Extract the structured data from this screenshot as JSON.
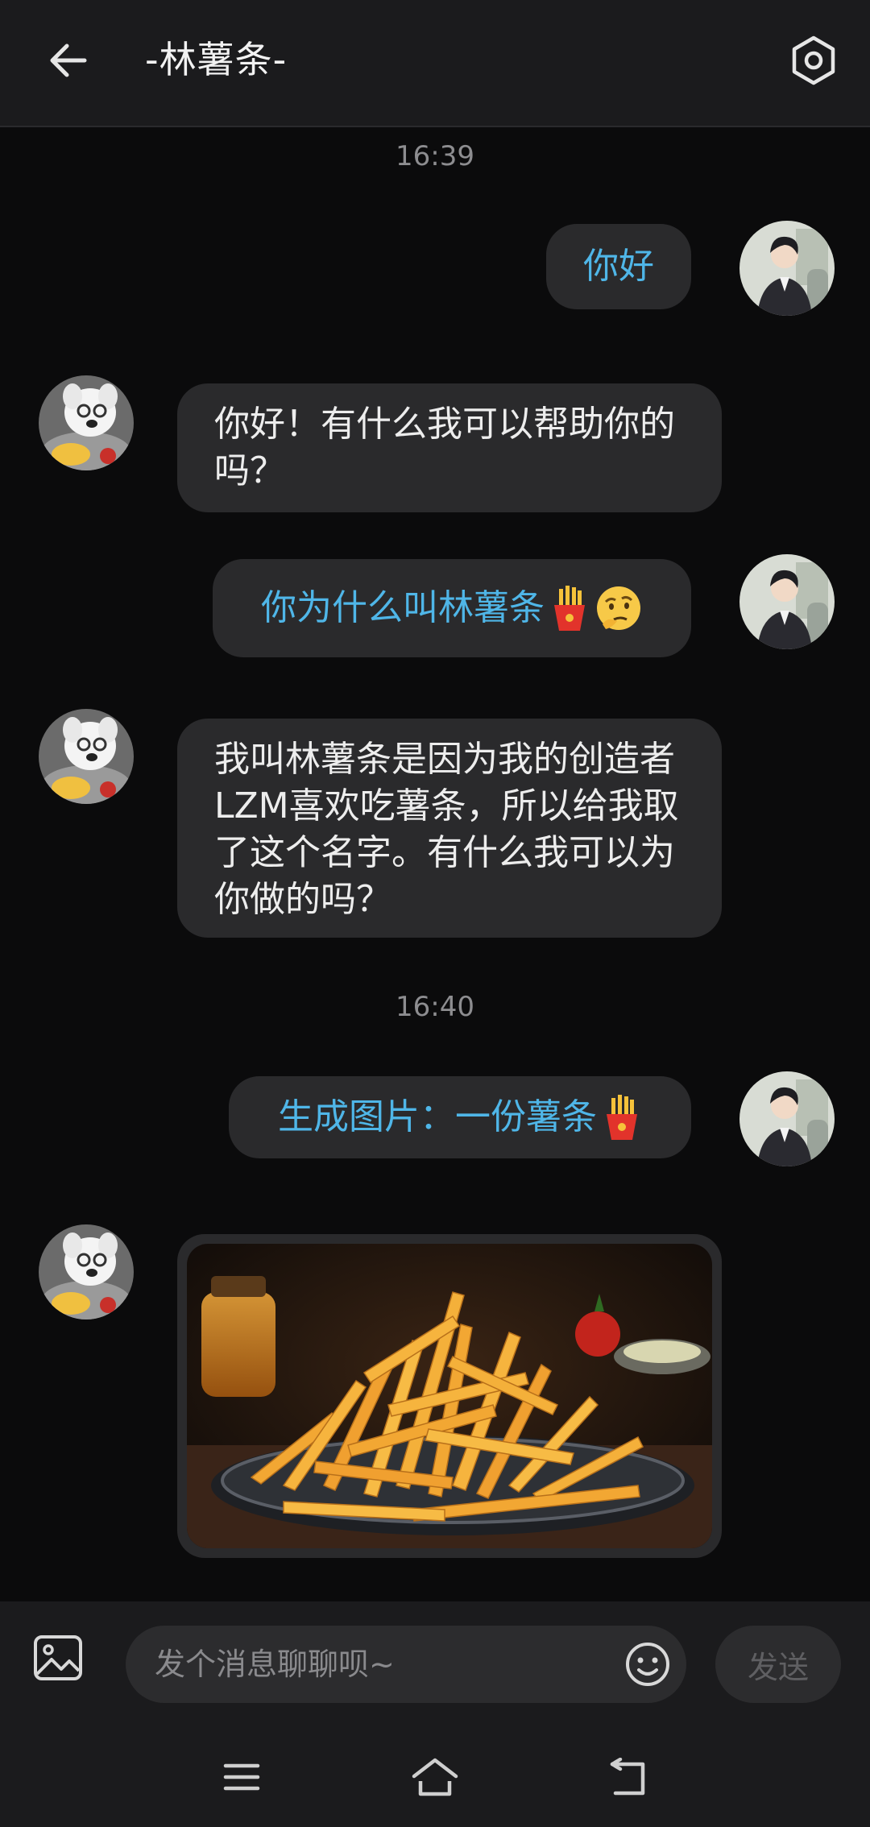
{
  "header": {
    "title": "-林薯条-",
    "back_icon": "arrow-left-icon",
    "settings_icon": "settings-hexagon-icon"
  },
  "messages": [
    {
      "type": "timestamp",
      "text": "16:39"
    },
    {
      "type": "user",
      "text": "你好"
    },
    {
      "type": "bot",
      "text": "你好！有什么我可以帮助你的吗？"
    },
    {
      "type": "user",
      "text": "你为什么叫林薯条",
      "emojis": [
        "fries-emoji",
        "thinking-face-emoji"
      ]
    },
    {
      "type": "bot",
      "text": "我叫林薯条是因为我的创造者LZM喜欢吃薯条，所以给我取了这个名字。有什么我可以为你做的吗？"
    },
    {
      "type": "timestamp",
      "text": "16:40"
    },
    {
      "type": "user",
      "text": "生成图片：一份薯条",
      "emojis": [
        "fries-emoji"
      ]
    },
    {
      "type": "bot-image",
      "image": "french-fries-plate"
    }
  ],
  "input": {
    "placeholder": "发个消息聊聊呗~",
    "send_label": "发送"
  },
  "colors": {
    "background": "#0b0b0c",
    "bubble": "#2a2a2c",
    "user_text": "#4fb6e8",
    "bot_text": "#ededed",
    "bar": "#1b1b1d"
  }
}
